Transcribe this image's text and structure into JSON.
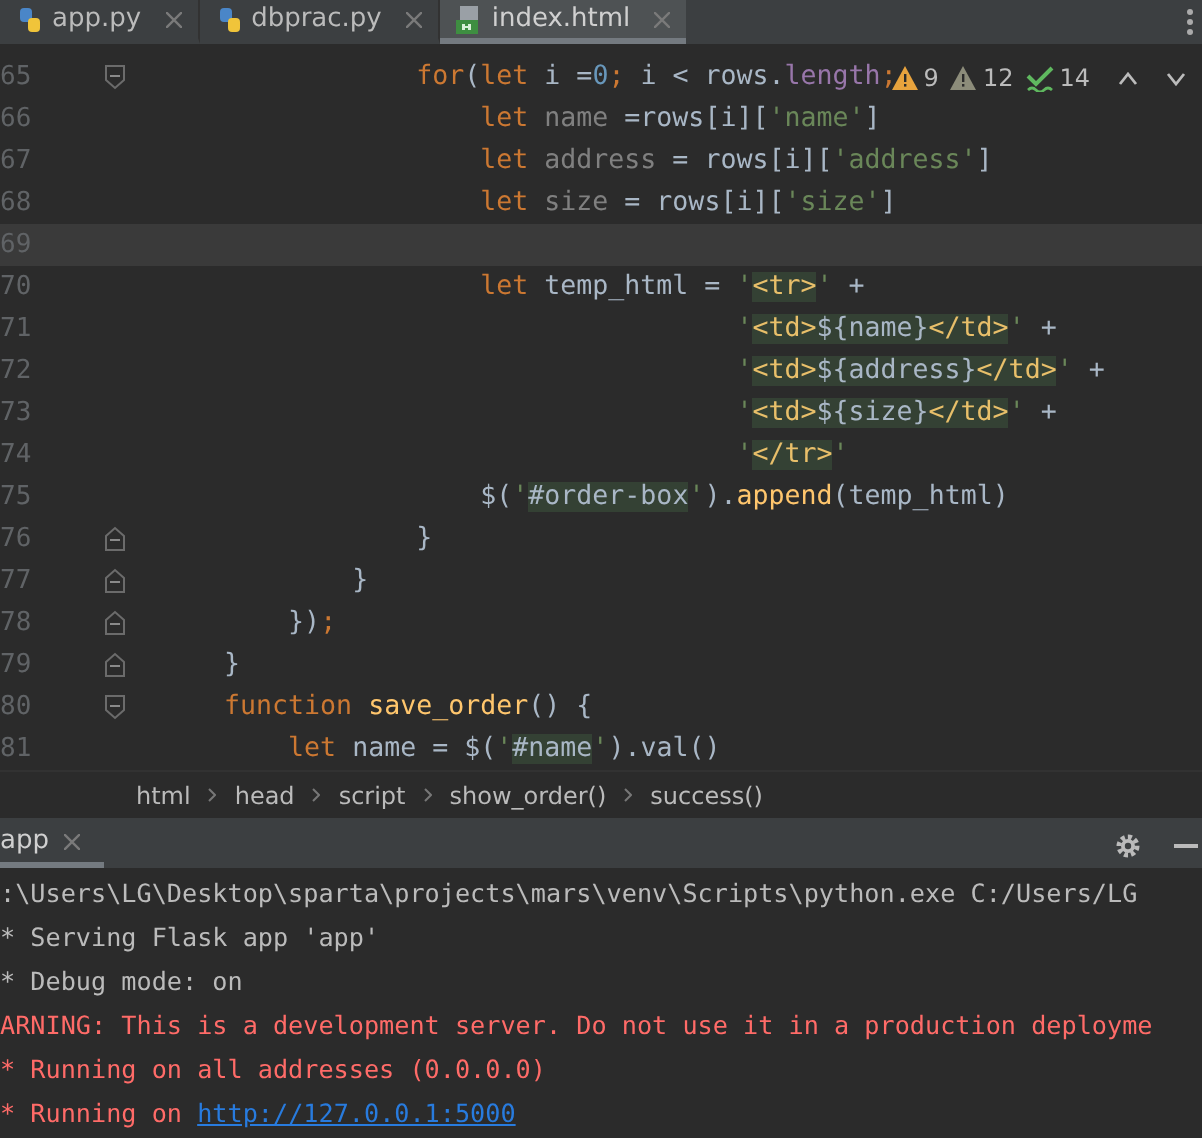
{
  "editor_tabs": [
    {
      "label": "app.py",
      "kind": "python",
      "selected": false
    },
    {
      "label": "dbprac.py",
      "kind": "python",
      "selected": false
    },
    {
      "label": "index.html",
      "kind": "html",
      "selected": true
    }
  ],
  "inspections": [
    {
      "kind": "warning",
      "count": "9"
    },
    {
      "kind": "weak",
      "count": "12"
    },
    {
      "kind": "typo",
      "count": "14"
    }
  ],
  "code_lines": [
    {
      "number": "65",
      "kind": "fold_start",
      "current": false,
      "tokens": [
        {
          "kind": "kw",
          "text": "                for"
        },
        {
          "kind": "plain",
          "text": "("
        },
        {
          "kind": "kw",
          "text": "let"
        },
        {
          "kind": "plain",
          "text": " i ="
        },
        {
          "kind": "num",
          "text": "0"
        },
        {
          "kind": "kw",
          "text": ";"
        },
        {
          "kind": "plain",
          "text": " i < rows."
        },
        {
          "kind": "prop",
          "text": "length"
        },
        {
          "kind": "kw",
          "text": ";"
        }
      ]
    },
    {
      "number": "66",
      "kind": "plain",
      "current": false,
      "tokens": [
        {
          "kind": "kw",
          "text": "                    let"
        },
        {
          "kind": "var",
          "text": " name"
        },
        {
          "kind": "plain",
          "text": " =rows[i]["
        },
        {
          "kind": "str",
          "text": "'name'"
        },
        {
          "kind": "plain",
          "text": "]"
        }
      ]
    },
    {
      "number": "67",
      "kind": "plain",
      "current": false,
      "tokens": [
        {
          "kind": "kw",
          "text": "                    let"
        },
        {
          "kind": "var",
          "text": " address"
        },
        {
          "kind": "plain",
          "text": " = rows[i]["
        },
        {
          "kind": "str",
          "text": "'address'"
        },
        {
          "kind": "plain",
          "text": "]"
        }
      ]
    },
    {
      "number": "68",
      "kind": "plain",
      "current": false,
      "tokens": [
        {
          "kind": "kw",
          "text": "                    let"
        },
        {
          "kind": "var",
          "text": " size"
        },
        {
          "kind": "plain",
          "text": " = rows[i]["
        },
        {
          "kind": "str",
          "text": "'size'"
        },
        {
          "kind": "plain",
          "text": "]"
        }
      ]
    },
    {
      "number": "69",
      "kind": "plain",
      "current": true
    },
    {
      "number": "70",
      "kind": "plain",
      "current": false,
      "tokens": [
        {
          "kind": "kw",
          "text": "                    let"
        },
        {
          "kind": "plain",
          "text": " temp_html = "
        },
        {
          "kind": "str",
          "text": "'"
        },
        {
          "kind": "tag",
          "text": "<tr>"
        },
        {
          "kind": "str",
          "text": "'"
        },
        {
          "kind": "plain",
          "text": " +"
        }
      ]
    },
    {
      "number": "71",
      "kind": "plain",
      "current": false,
      "tokens": [
        {
          "kind": "str",
          "text": "                                    '"
        },
        {
          "kind": "tag",
          "text": "<td>"
        },
        {
          "kind": "interp",
          "text": "${name}"
        },
        {
          "kind": "tag",
          "text": "</td>"
        },
        {
          "kind": "str",
          "text": "'"
        },
        {
          "kind": "plain",
          "text": " +"
        }
      ]
    },
    {
      "number": "72",
      "kind": "plain",
      "current": false,
      "tokens": [
        {
          "kind": "str",
          "text": "                                    '"
        },
        {
          "kind": "tag",
          "text": "<td>"
        },
        {
          "kind": "interp",
          "text": "${address}"
        },
        {
          "kind": "tag",
          "text": "</td>"
        },
        {
          "kind": "str",
          "text": "'"
        },
        {
          "kind": "plain",
          "text": " +"
        }
      ]
    },
    {
      "number": "73",
      "kind": "plain",
      "current": false,
      "tokens": [
        {
          "kind": "str",
          "text": "                                    '"
        },
        {
          "kind": "tag",
          "text": "<td>"
        },
        {
          "kind": "interp",
          "text": "${size}"
        },
        {
          "kind": "tag",
          "text": "</td>"
        },
        {
          "kind": "str",
          "text": "'"
        },
        {
          "kind": "plain",
          "text": " +"
        }
      ]
    },
    {
      "number": "74",
      "kind": "plain",
      "current": false,
      "tokens": [
        {
          "kind": "str",
          "text": "                                    '"
        },
        {
          "kind": "tag",
          "text": "</tr>"
        },
        {
          "kind": "str",
          "text": "'"
        }
      ]
    },
    {
      "number": "75",
      "kind": "plain",
      "current": false,
      "tokens": [
        {
          "kind": "plain",
          "text": "                    $("
        },
        {
          "kind": "str",
          "text": "'"
        },
        {
          "kind": "sel",
          "text": "#order-box"
        },
        {
          "kind": "str",
          "text": "'"
        },
        {
          "kind": "plain",
          "text": ")."
        },
        {
          "kind": "fn",
          "text": "append"
        },
        {
          "kind": "plain",
          "text": "(temp_html)"
        }
      ]
    },
    {
      "number": "76",
      "kind": "fold_end",
      "current": false,
      "tokens": [
        {
          "kind": "plain",
          "text": "                }"
        }
      ]
    },
    {
      "number": "77",
      "kind": "fold_end",
      "current": false,
      "tokens": [
        {
          "kind": "plain",
          "text": "            }"
        }
      ]
    },
    {
      "number": "78",
      "kind": "fold_end",
      "current": false,
      "tokens": [
        {
          "kind": "plain",
          "text": "        })"
        },
        {
          "kind": "kw",
          "text": ";"
        }
      ]
    },
    {
      "number": "79",
      "kind": "fold_end",
      "current": false,
      "tokens": [
        {
          "kind": "plain",
          "text": "    }"
        }
      ]
    },
    {
      "number": "80",
      "kind": "fold_start",
      "current": false,
      "tokens": [
        {
          "kind": "kw",
          "text": "    function"
        },
        {
          "kind": "fn",
          "text": " save_order"
        },
        {
          "kind": "plain",
          "text": "() {"
        }
      ]
    },
    {
      "number": "81",
      "kind": "plain",
      "current": false,
      "tokens": [
        {
          "kind": "kw",
          "text": "        let"
        },
        {
          "kind": "plain",
          "text": " name = $("
        },
        {
          "kind": "str",
          "text": "'"
        },
        {
          "kind": "sel",
          "text": "#name"
        },
        {
          "kind": "str",
          "text": "'"
        },
        {
          "kind": "plain",
          "text": ").val()"
        }
      ]
    }
  ],
  "breadcrumbs": [
    "html",
    "head",
    "script",
    "show_order()",
    "success()"
  ],
  "run_tab": {
    "label": "app",
    "selected": true
  },
  "console_lines": [
    {
      "kind": "plain",
      "segments": [
        {
          "kind": "text",
          "text": ":\\Users\\LG\\Desktop\\sparta\\projects\\mars\\venv\\Scripts\\python.exe C:/Users/LG"
        }
      ]
    },
    {
      "kind": "plain",
      "segments": [
        {
          "kind": "text",
          "text": "* Serving Flask app 'app'"
        }
      ]
    },
    {
      "kind": "plain",
      "segments": [
        {
          "kind": "text",
          "text": "* Debug mode: on"
        }
      ]
    },
    {
      "kind": "error",
      "segments": [
        {
          "kind": "text",
          "text": "ARNING: This is a development server. Do not use it in a production deployme"
        }
      ]
    },
    {
      "kind": "error",
      "segments": [
        {
          "kind": "text",
          "text": "* Running on all addresses (0.0.0.0)"
        }
      ]
    },
    {
      "kind": "error",
      "segments": [
        {
          "kind": "text",
          "text": "* Running on "
        },
        {
          "kind": "link",
          "text": "http://127.0.0.1:5000"
        }
      ]
    }
  ]
}
